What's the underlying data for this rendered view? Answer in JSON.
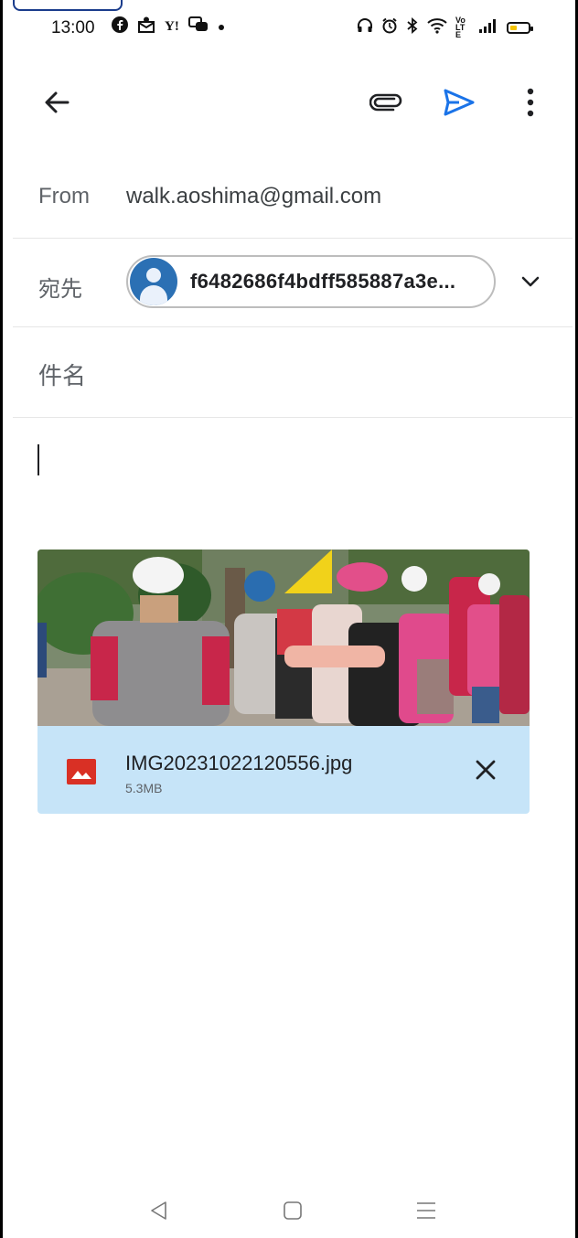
{
  "status_bar": {
    "time": "13:00",
    "left_icons": [
      "facebook-icon",
      "mail-alert-icon",
      "yahoo-icon",
      "chat-icon",
      "dot-icon"
    ],
    "right_icons": [
      "headphones-icon",
      "alarm-icon",
      "bluetooth-icon",
      "wifi-icon",
      "volte-icon",
      "signal-icon",
      "battery-icon"
    ],
    "yahoo_text": "Y!",
    "volte_text": "Vo LTE"
  },
  "toolbar": {
    "icons": [
      "back-arrow-icon",
      "attach-icon",
      "send-icon",
      "more-vert-icon"
    ],
    "send_color": "#1a73e8"
  },
  "compose": {
    "from_label": "From",
    "from_value": "walk.aoshima@gmail.com",
    "to_label": "宛先",
    "to_chip": "f6482686f4bdff585887a3e...",
    "subject_label": "件名",
    "body": ""
  },
  "attachment": {
    "file_name": "IMG20231022120556.jpg",
    "file_size": "5.3MB",
    "icon": "image-file-icon",
    "icon_color": "#d93025",
    "bar_color": "#c6e4f8"
  },
  "nav_bar": {
    "icons": [
      "nav-back-icon",
      "nav-home-icon",
      "nav-menu-icon"
    ]
  }
}
